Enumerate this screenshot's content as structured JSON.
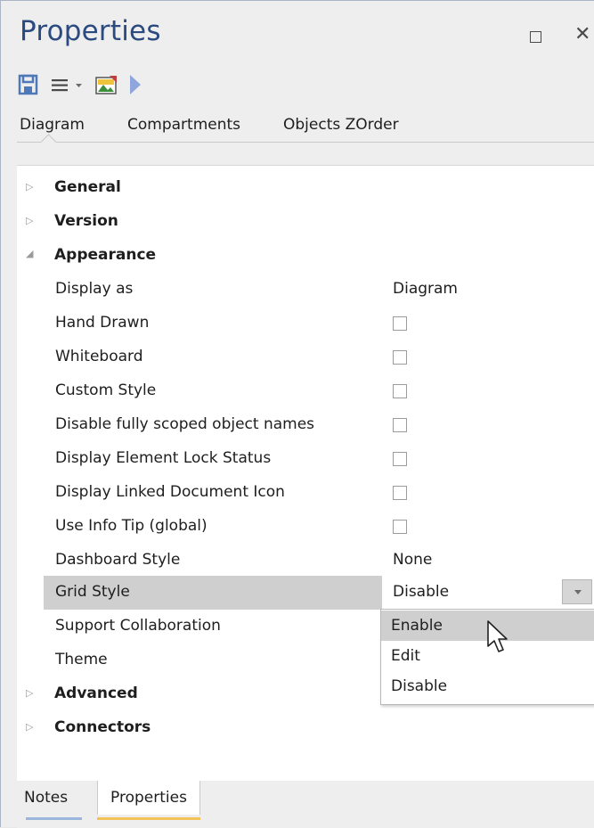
{
  "window": {
    "title": "Properties"
  },
  "toolbar": {
    "icons": [
      "save-icon",
      "menu-icon",
      "image-icon",
      "play-icon"
    ]
  },
  "tabs": [
    {
      "label": "Diagram"
    },
    {
      "label": "Compartments"
    },
    {
      "label": "Objects ZOrder"
    }
  ],
  "categories": {
    "general": "General",
    "version": "Version",
    "appearance": "Appearance",
    "advanced": "Advanced",
    "connectors": "Connectors"
  },
  "properties": {
    "display_as": {
      "label": "Display as",
      "value": "Diagram"
    },
    "hand_drawn": {
      "label": "Hand Drawn",
      "checked": false
    },
    "whiteboard": {
      "label": "Whiteboard",
      "checked": false
    },
    "custom_style": {
      "label": "Custom Style",
      "checked": false
    },
    "disable_scoped": {
      "label": "Disable fully scoped object names",
      "checked": false
    },
    "lock_status": {
      "label": "Display Element Lock Status",
      "checked": false
    },
    "linked_doc": {
      "label": "Display Linked Document Icon",
      "checked": false
    },
    "info_tip": {
      "label": "Use Info Tip (global)",
      "checked": false
    },
    "dashboard_style": {
      "label": "Dashboard Style",
      "value": "None"
    },
    "grid_style": {
      "label": "Grid Style",
      "value": "Disable"
    },
    "support_collab": {
      "label": "Support Collaboration"
    },
    "theme": {
      "label": "Theme"
    }
  },
  "dropdown": {
    "options": [
      "Enable",
      "Edit",
      "Disable"
    ],
    "highlighted": "Enable"
  },
  "bottom_tabs": {
    "notes": "Notes",
    "properties": "Properties"
  },
  "colors": {
    "title": "#2b4a80",
    "accent_tab": "#f3c35a",
    "notes_tab": "#9bb6dd"
  }
}
